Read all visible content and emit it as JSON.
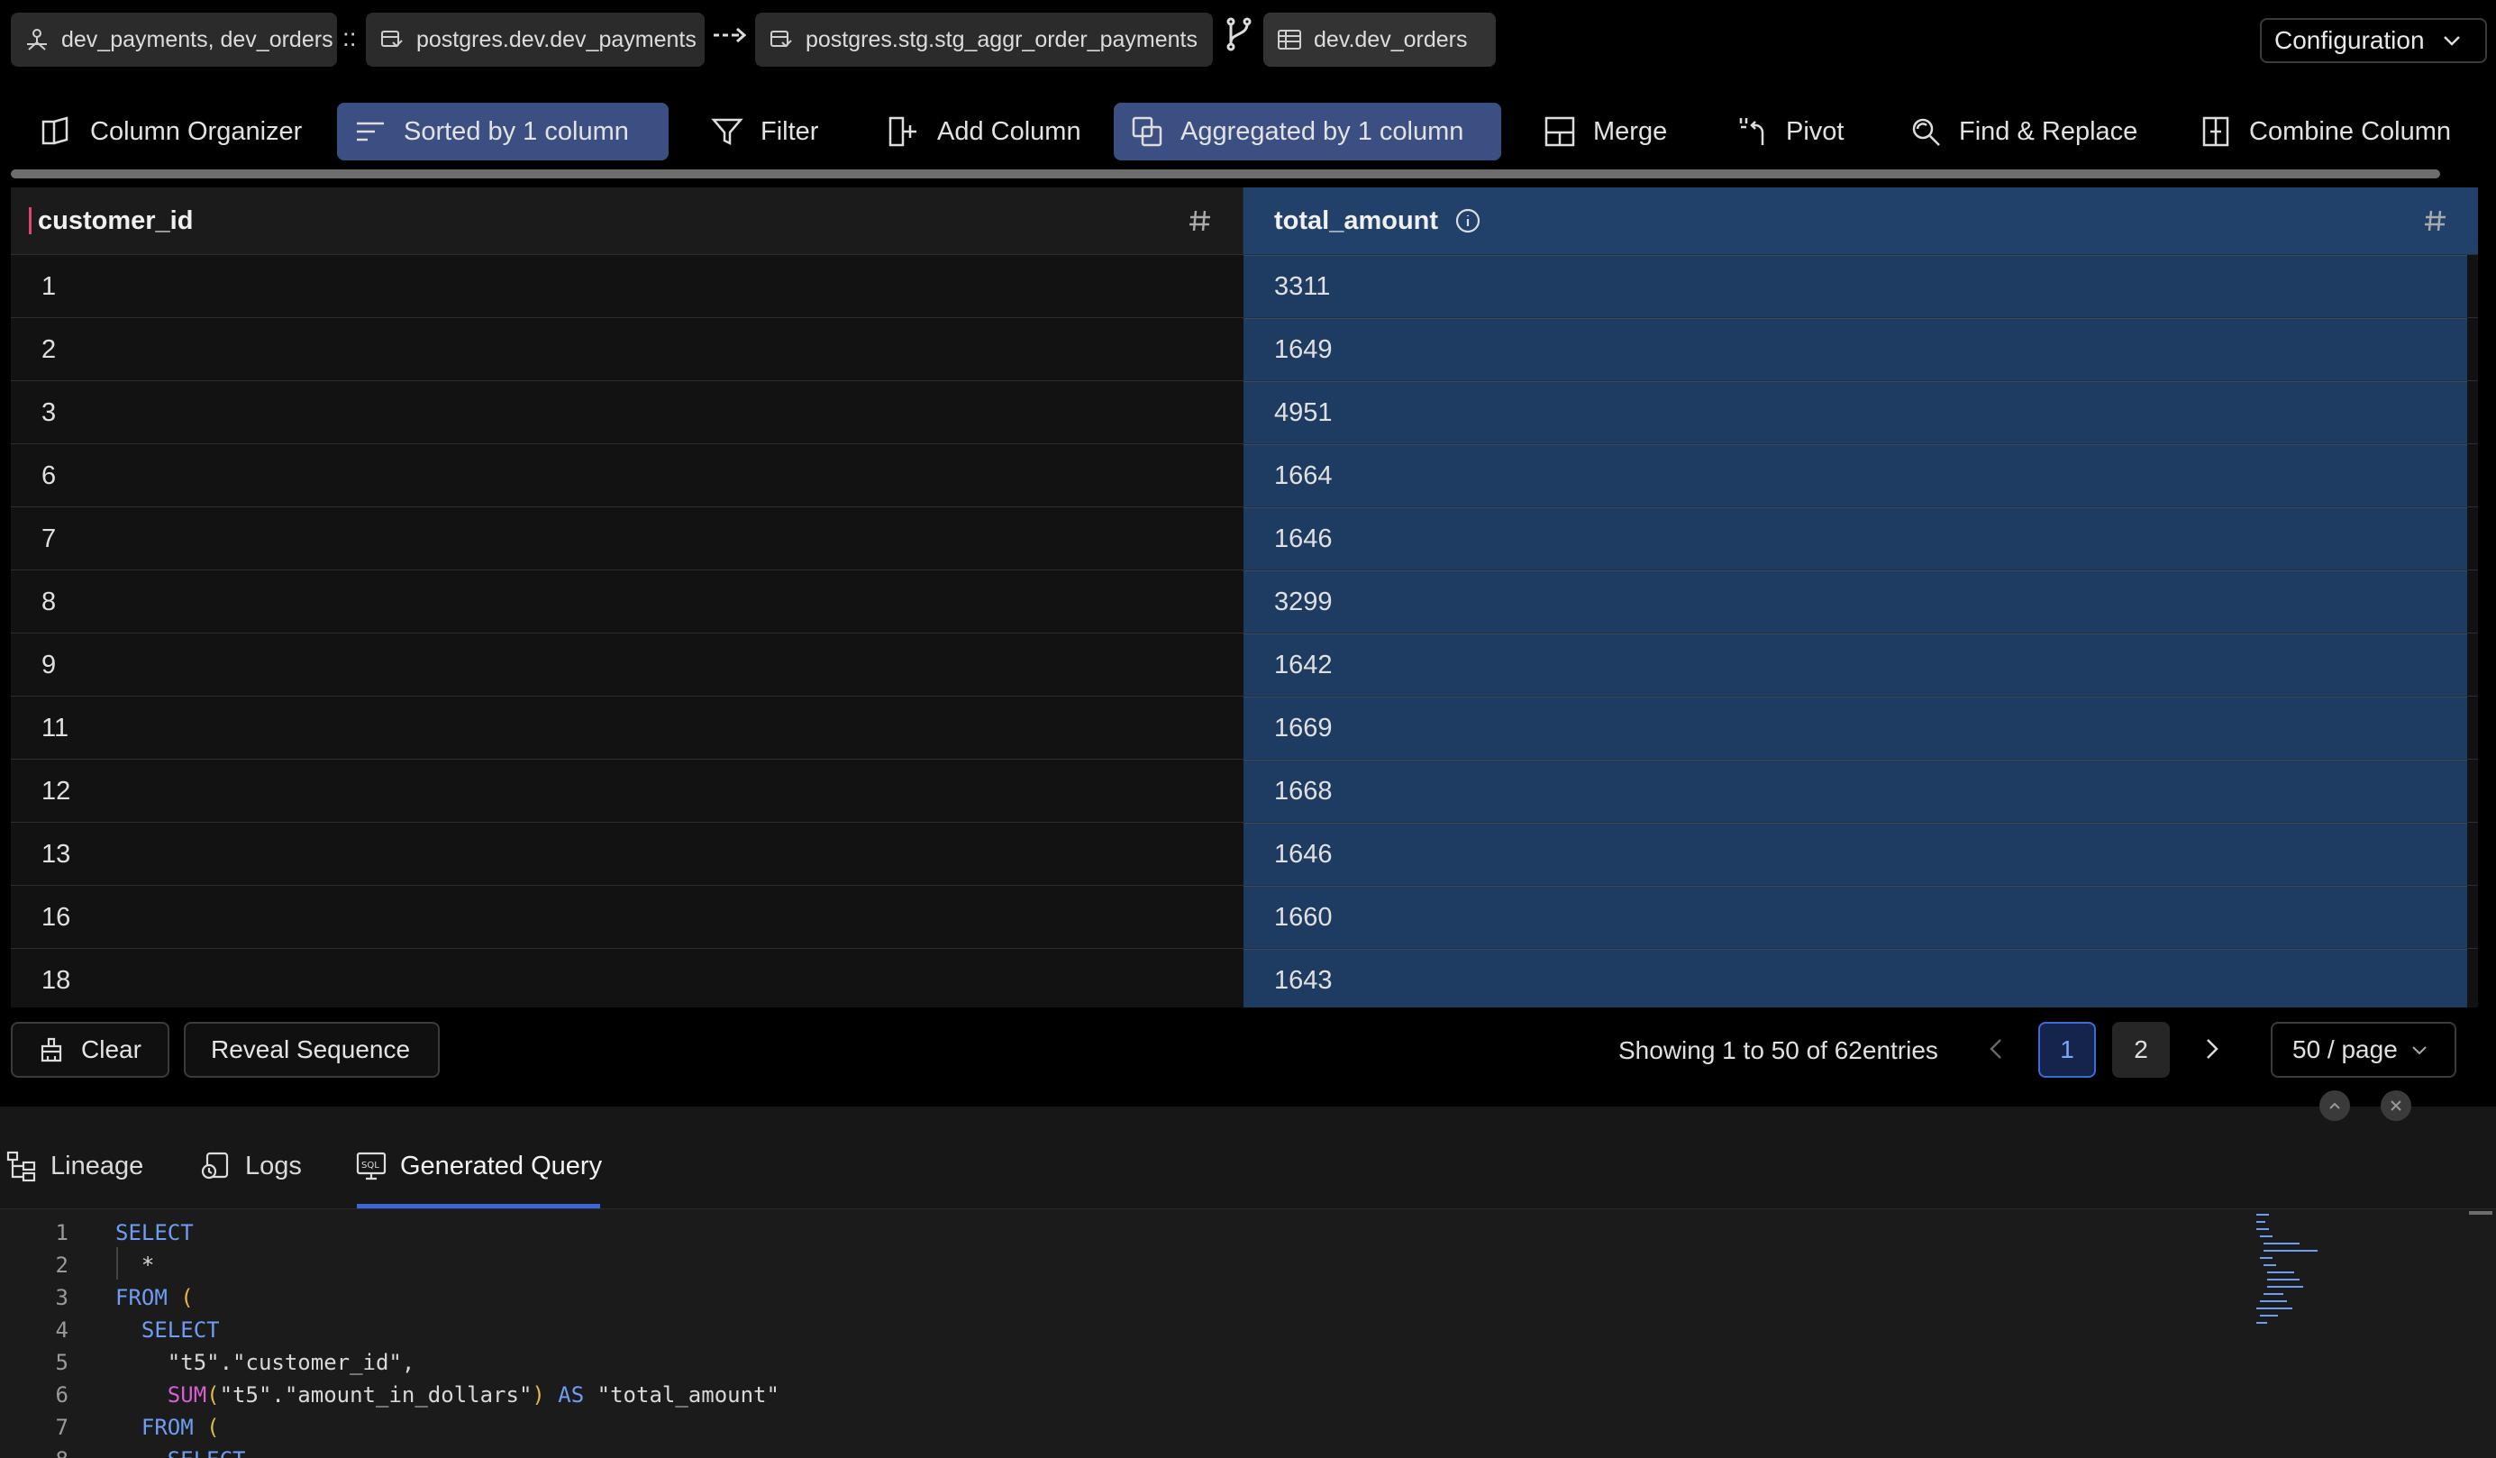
{
  "breadcrumbs": {
    "source": "dev_payments, dev_orders",
    "separator": "::",
    "payments_model": "postgres.dev.dev_payments",
    "stg_model": "postgres.stg.stg_aggr_order_payments",
    "orders_model": "dev.dev_orders"
  },
  "config_label": "Configuration",
  "toolbar": {
    "column_organizer": "Column Organizer",
    "sorted": "Sorted by 1 column",
    "filter": "Filter",
    "add_column": "Add Column",
    "aggregated": "Aggregated by 1 column",
    "merge": "Merge",
    "pivot": "Pivot",
    "find_replace": "Find & Replace",
    "combine_column": "Combine Column"
  },
  "table": {
    "columns": [
      "customer_id",
      "total_amount"
    ],
    "rows": [
      [
        "1",
        "3311"
      ],
      [
        "2",
        "1649"
      ],
      [
        "3",
        "4951"
      ],
      [
        "6",
        "1664"
      ],
      [
        "7",
        "1646"
      ],
      [
        "8",
        "3299"
      ],
      [
        "9",
        "1642"
      ],
      [
        "11",
        "1669"
      ],
      [
        "12",
        "1668"
      ],
      [
        "13",
        "1646"
      ],
      [
        "16",
        "1660"
      ],
      [
        "18",
        "1643"
      ]
    ]
  },
  "footer": {
    "clear": "Clear",
    "reveal": "Reveal Sequence",
    "showing": "Showing 1 to 50 of 62entries",
    "page1": "1",
    "page2": "2",
    "per_page": "50 / page"
  },
  "panel": {
    "tabs": [
      "Lineage",
      "Logs",
      "Generated Query"
    ],
    "line_numbers": [
      "1",
      "2",
      "3",
      "4",
      "5",
      "6",
      "7",
      "8"
    ]
  },
  "colors": {
    "accent": "#3e64d6",
    "active_tab_bg": "#3c4f82",
    "highlight_column": "#1e3c62",
    "keyword": "#6f9df2",
    "function": "#d75fd0"
  }
}
